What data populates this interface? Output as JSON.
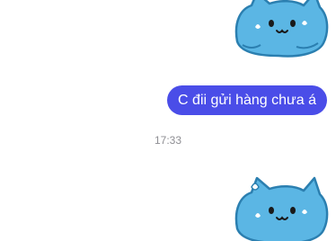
{
  "conversation": {
    "messages": [
      {
        "type": "sticker",
        "sender": "self",
        "sticker_name": "blue-cat-sweating-sticker"
      },
      {
        "type": "text",
        "sender": "self",
        "text": "C đii gửi hàng chưa á"
      },
      {
        "type": "timestamp",
        "text": "17:33"
      },
      {
        "type": "sticker",
        "sender": "self",
        "sticker_name": "blue-cat-sweating-sticker"
      }
    ]
  },
  "colors": {
    "bubble_background": "#4a4de8",
    "bubble_text": "#ffffff",
    "timestamp_text": "#8e8e93",
    "sticker_cat_body": "#5bb6e4",
    "background": "#ffffff"
  }
}
